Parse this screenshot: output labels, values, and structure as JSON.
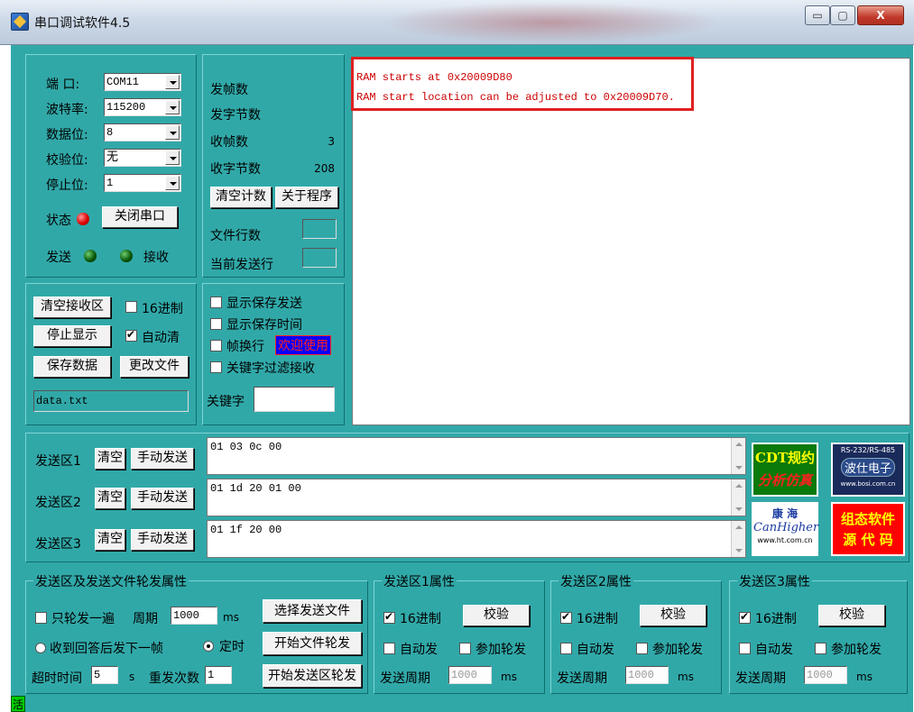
{
  "window": {
    "title": "串口调试软件4.5",
    "minimize": "▭",
    "maximize": "▢",
    "close": "X"
  },
  "serial": {
    "port_label": "端  口:",
    "port_value": "COM11",
    "baud_label": "波特率:",
    "baud_value": "115200",
    "data_label": "数据位:",
    "data_value": "8",
    "parity_label": "校验位:",
    "parity_value": "无",
    "stop_label": "停止位:",
    "stop_value": "1",
    "status_label": "状态",
    "close_port_button": "关闭串口",
    "send_label": "发送",
    "recv_label": "接收"
  },
  "counters": {
    "sent_frames_label": "发帧数",
    "sent_frames_value": "",
    "sent_bytes_label": "发字节数",
    "sent_bytes_value": "",
    "recv_frames_label": "收帧数",
    "recv_frames_value": "3",
    "recv_bytes_label": "收字节数",
    "recv_bytes_value": "208",
    "clear_count_button": "清空计数",
    "about_button": "关于程序",
    "file_lines_label": "文件行数",
    "current_line_label": "当前发送行"
  },
  "receive_controls": {
    "clear_button": "清空接收区",
    "hex_label": "16进制",
    "stop_display_button": "停止显示",
    "auto_clear_label": "自动清",
    "save_data_button": "保存数据",
    "change_file_button": "更改文件",
    "filename": "data.txt"
  },
  "options": {
    "show_save_send": "显示保存发送",
    "show_save_time": "显示保存时间",
    "frame_newline": "帧换行",
    "welcome": "欢迎使用",
    "keyword_filter": "关键字过滤接收",
    "keyword_label": "关键字"
  },
  "receive_area": {
    "lines": [
      "RAM starts at 0x20009D80",
      "RAM start location can be adjusted to 0x20009D70."
    ]
  },
  "send_areas": [
    {
      "label": "发送区1",
      "clear": "清空",
      "manual_send": "手动发送",
      "content": "01 03 0c 00"
    },
    {
      "label": "发送区2",
      "clear": "清空",
      "manual_send": "手动发送",
      "content": "01 1d 20 01 00"
    },
    {
      "label": "发送区3",
      "clear": "清空",
      "manual_send": "手动发送",
      "content": "01 1f 20 00"
    }
  ],
  "ads": {
    "cdt_line1": "CDT规约",
    "cdt_line2": "分析仿真",
    "rs_line1": "RS-232/RS-485",
    "rs_line2": "波仕电子",
    "rs_line3": "www.bosi.com.cn",
    "kh_line1": "康 海",
    "kh_line2": "CanHigher",
    "kh_line3": "www.ht.com.cn",
    "zt_line1": "组态软件",
    "zt_line2": "源 代 码"
  },
  "rotation": {
    "legend": "发送区及发送文件轮发属性",
    "once_label": "只轮发一遍",
    "period_label": "周期",
    "period_value": "1000",
    "ms": "ms",
    "select_file_button": "选择发送文件",
    "reply_next_label": "收到回答后发下一帧",
    "timed_label": "定时",
    "start_file_rotation_button": "开始文件轮发",
    "timeout_label": "超时时间",
    "timeout_value": "5",
    "s_unit": "s",
    "resend_label": "重发次数",
    "resend_value": "1",
    "start_area_rotation_button": "开始发送区轮发"
  },
  "area_props": [
    {
      "legend": "发送区1属性",
      "hex": "16进制",
      "check_button": "校验",
      "auto_send": "自动发",
      "join_rotation": "参加轮发",
      "period_label": "发送周期",
      "period_value": "1000",
      "ms": "ms"
    },
    {
      "legend": "发送区2属性",
      "hex": "16进制",
      "check_button": "校验",
      "auto_send": "自动发",
      "join_rotation": "参加轮发",
      "period_label": "发送周期",
      "period_value": "1000",
      "ms": "ms"
    },
    {
      "legend": "发送区3属性",
      "hex": "16进制",
      "check_button": "校验",
      "auto_send": "自动发",
      "join_rotation": "参加轮发",
      "period_label": "发送周期",
      "period_value": "1000",
      "ms": "ms"
    }
  ],
  "status_corner": "活",
  "colors": {
    "background": "#31a8a8",
    "receive_text": "#cc0000",
    "highlight_box": "#e02020",
    "welcome_bg": "#0000ff",
    "welcome_text": "#ff2020"
  }
}
